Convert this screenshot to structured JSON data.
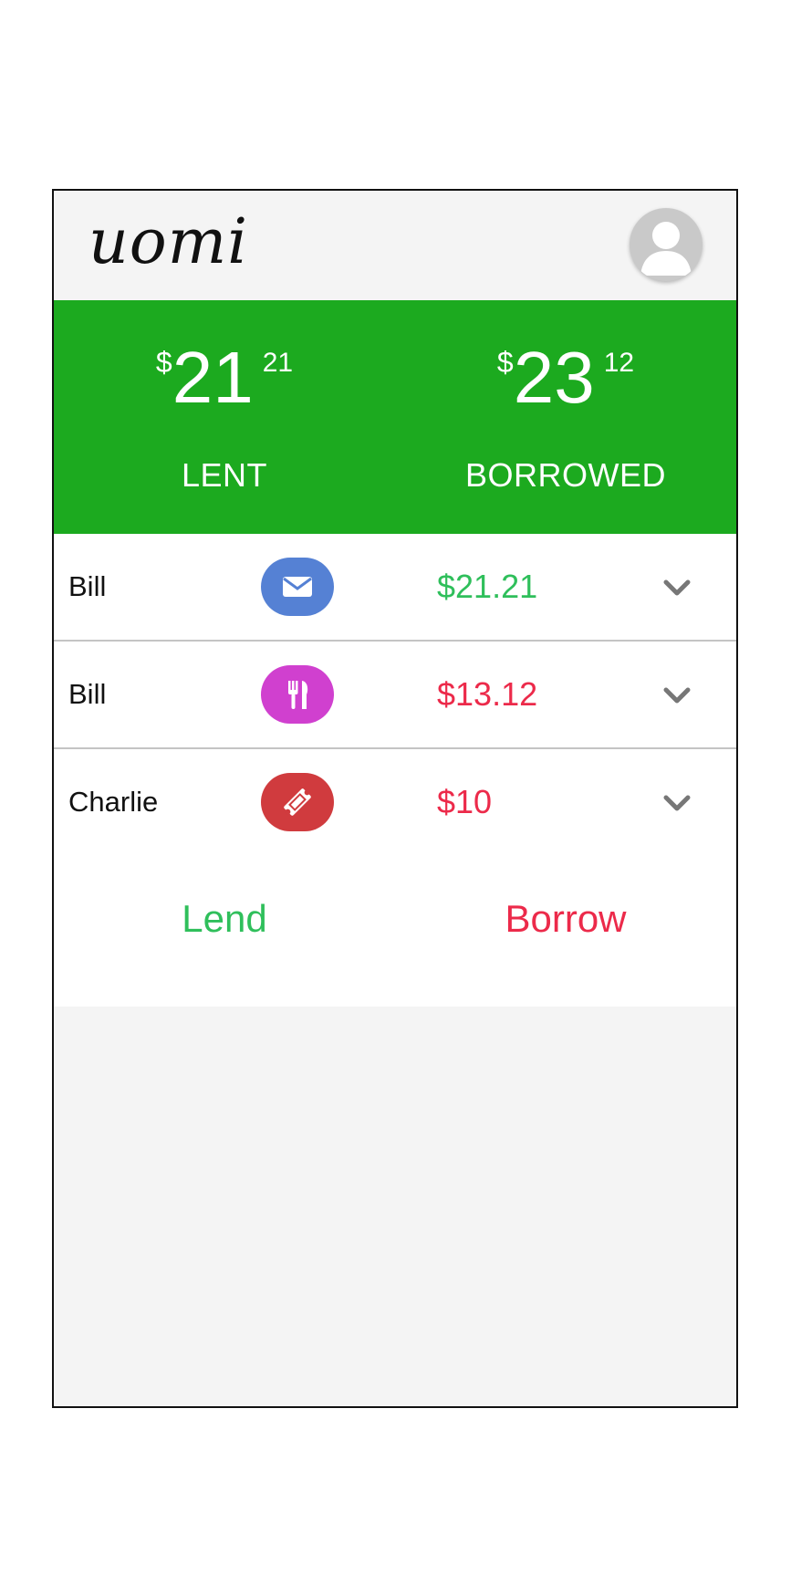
{
  "app": {
    "logo_text": "uomi",
    "avatar_icon": "user-avatar-icon"
  },
  "summary": {
    "lent": {
      "currency": "$",
      "whole": "21",
      "cents": "21",
      "label": "LENT"
    },
    "borrowed": {
      "currency": "$",
      "whole": "23",
      "cents": "12",
      "label": "BORROWED"
    }
  },
  "transactions": [
    {
      "name": "Bill",
      "amount": "$21.21",
      "type": "lent",
      "icon": "envelope-icon",
      "icon_color": "#5581d4",
      "amount_color": "#2fbf5b",
      "expand_icon": "chevron-down-icon"
    },
    {
      "name": "Bill",
      "amount": "$13.12",
      "type": "borrowed",
      "icon": "utensils-icon",
      "icon_color": "#d040cf",
      "amount_color": "#ec2a4a",
      "expand_icon": "chevron-down-icon"
    },
    {
      "name": "Charlie",
      "amount": "$10",
      "type": "borrowed",
      "icon": "ticket-icon",
      "icon_color": "#d03b3e",
      "amount_color": "#ec2a4a",
      "expand_icon": "chevron-down-icon"
    }
  ],
  "actions": {
    "lend_label": "Lend",
    "borrow_label": "Borrow"
  },
  "colors": {
    "header_green": "#1caa1f",
    "lent_green": "#2fbf5b",
    "borrow_red": "#ec2a4a",
    "background": "#f4f4f4"
  }
}
